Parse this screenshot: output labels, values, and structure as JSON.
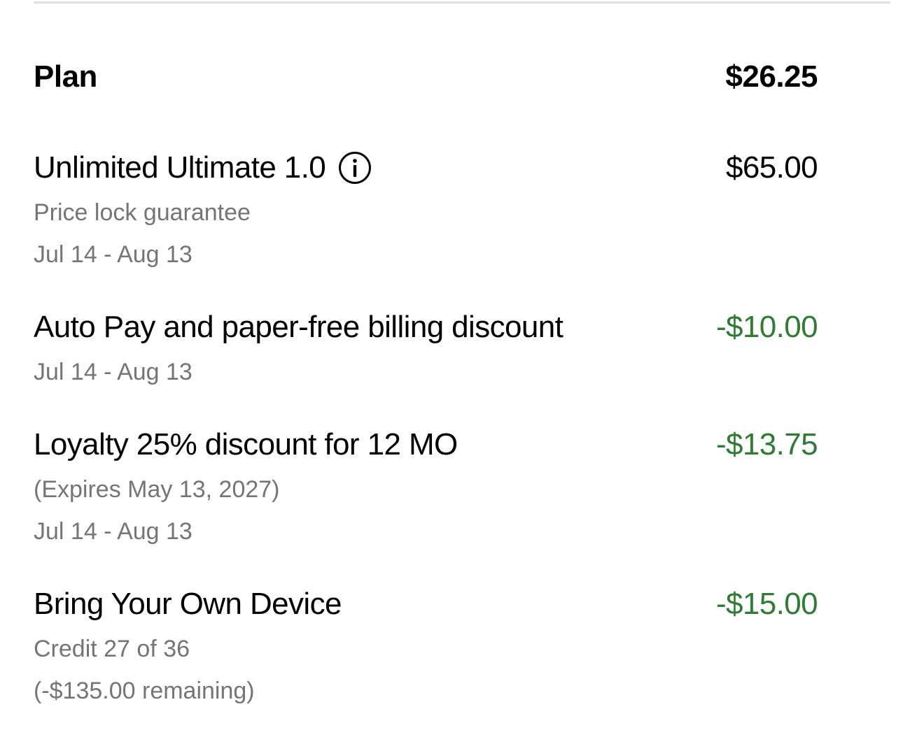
{
  "header": {
    "label": "Plan",
    "amount": "$26.25"
  },
  "items": [
    {
      "title": "Unlimited Ultimate 1.0",
      "amount": "$65.00",
      "has_info_icon": true,
      "details": [
        "Price lock guarantee",
        "Jul 14 - Aug 13"
      ]
    },
    {
      "title": "Auto Pay and paper-free billing discount",
      "amount": "-$10.00",
      "details": [
        "Jul 14 - Aug 13"
      ]
    },
    {
      "title": "Loyalty 25% discount for 12 MO",
      "amount": "-$13.75",
      "details": [
        "(Expires May 13, 2027)",
        "Jul 14 - Aug 13"
      ]
    },
    {
      "title": "Bring Your Own Device",
      "amount": "-$15.00",
      "details": [
        "Credit 27 of 36",
        "(-$135.00 remaining)"
      ]
    }
  ],
  "colors": {
    "credit_amount": "#2e7d32",
    "secondary_text": "#757575",
    "divider": "#e1e1e1"
  },
  "icons": {
    "info": "info-circle-icon"
  }
}
